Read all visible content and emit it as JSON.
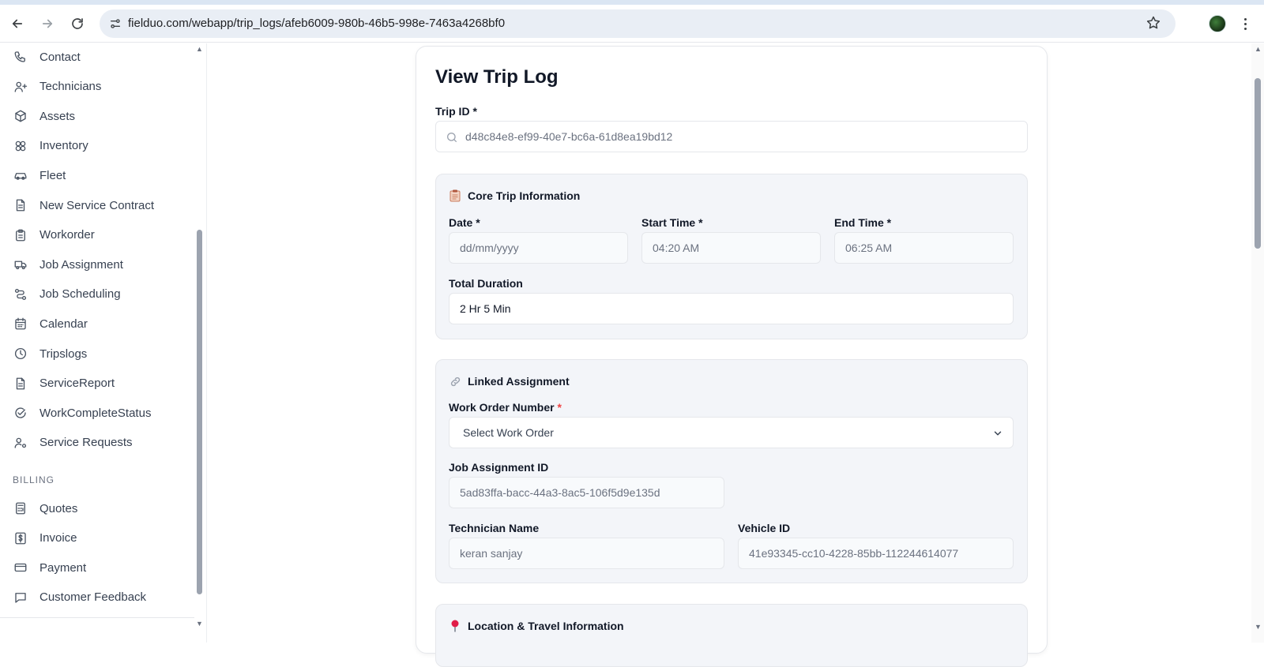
{
  "browser": {
    "url": "fielduo.com/webapp/trip_logs/afeb6009-980b-46b5-998e-7463a4268bf0"
  },
  "sidebar": {
    "items": [
      {
        "label": "Contact",
        "icon": "phone-icon"
      },
      {
        "label": "Technicians",
        "icon": "user-plus-icon"
      },
      {
        "label": "Assets",
        "icon": "box-icon"
      },
      {
        "label": "Inventory",
        "icon": "boxes-icon"
      },
      {
        "label": "Fleet",
        "icon": "car-icon"
      },
      {
        "label": "New Service Contract",
        "icon": "file-text-icon"
      },
      {
        "label": "Workorder",
        "icon": "clipboard-icon"
      },
      {
        "label": "Job Assignment",
        "icon": "truck-icon"
      },
      {
        "label": "Job Scheduling",
        "icon": "route-icon"
      },
      {
        "label": "Calendar",
        "icon": "calendar-icon"
      },
      {
        "label": "Tripslogs",
        "icon": "clock-icon"
      },
      {
        "label": "ServiceReport",
        "icon": "file-text-icon"
      },
      {
        "label": "WorkCompleteStatus",
        "icon": "check-circle-icon"
      },
      {
        "label": "Service Requests",
        "icon": "user-cog-icon"
      }
    ],
    "billing_heading": "BILLING",
    "billing_items": [
      {
        "label": "Quotes",
        "icon": "calculator-icon"
      },
      {
        "label": "Invoice",
        "icon": "dollar-icon"
      },
      {
        "label": "Payment",
        "icon": "credit-card-icon"
      },
      {
        "label": "Customer Feedback",
        "icon": "message-icon"
      }
    ]
  },
  "form": {
    "title": "View Trip Log",
    "trip_id_label": "Trip ID",
    "required_mark": "*",
    "trip_id_value": "d48c84e8-ef99-40e7-bc6a-61d8ea19bd12",
    "core": {
      "title": "Core Trip Information",
      "icon": "clipboard-emoji-icon",
      "date_label": "Date",
      "date_placeholder": "dd/mm/yyyy",
      "start_label": "Start Time",
      "start_value": "04:20 AM",
      "end_label": "End Time",
      "end_value": "06:25 AM",
      "duration_label": "Total Duration",
      "duration_value": "2 Hr 5 Min"
    },
    "linked": {
      "title": "Linked Assignment",
      "icon": "link-emoji-icon",
      "work_order_label": "Work Order Number",
      "work_order_value": "Select Work Order",
      "job_assignment_label": "Job Assignment ID",
      "job_assignment_value": "5ad83ffa-bacc-44a3-8ac5-106f5d9e135d",
      "technician_label": "Technician Name",
      "technician_value": "keran sanjay",
      "vehicle_label": "Vehicle ID",
      "vehicle_value": "41e93345-cc10-4228-85bb-112244614077"
    },
    "location": {
      "title": "Location & Travel Information",
      "icon": "pin-emoji-icon"
    }
  },
  "colors": {
    "required": "#ef4444",
    "section_bg": "#f3f5f9",
    "address_bar": "#e9eef5"
  }
}
